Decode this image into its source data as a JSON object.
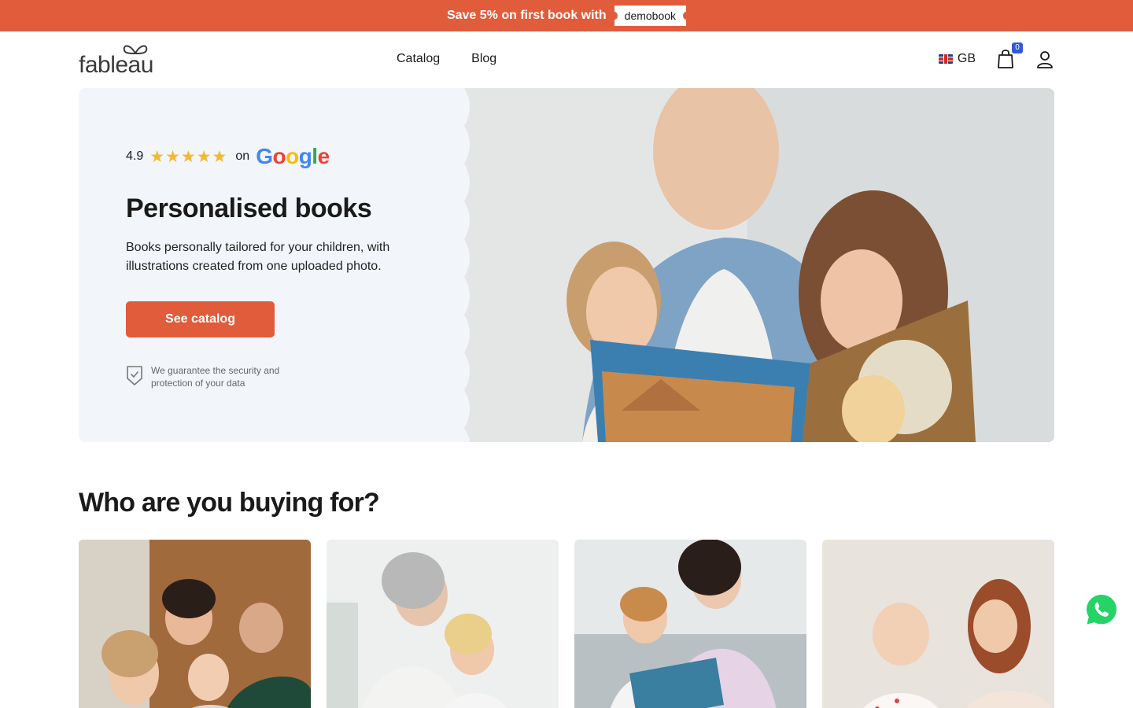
{
  "promo": {
    "text": "Save 5% on first book with",
    "code": "demobook"
  },
  "header": {
    "logo": "fableau",
    "nav": [
      {
        "label": "Catalog"
      },
      {
        "label": "Blog"
      }
    ],
    "language": "GB",
    "cart_count": "0"
  },
  "hero": {
    "rating_value": "4.9",
    "stars": "★★★★★",
    "rating_on": "on",
    "rating_source": [
      "G",
      "o",
      "o",
      "g",
      "l",
      "e"
    ],
    "title": "Personalised books",
    "description": "Books personally tailored for your children, with illustrations created from one uploaded photo.",
    "cta_label": "See catalog",
    "security_text": "We guarantee the security and protection of your data"
  },
  "section": {
    "title": "Who are you buying for?"
  },
  "colors": {
    "accent": "#e05c3a",
    "badge": "#2f5bd9",
    "hero_bg": "#f2f6fb",
    "star": "#f5b82e",
    "whatsapp": "#25d366"
  }
}
